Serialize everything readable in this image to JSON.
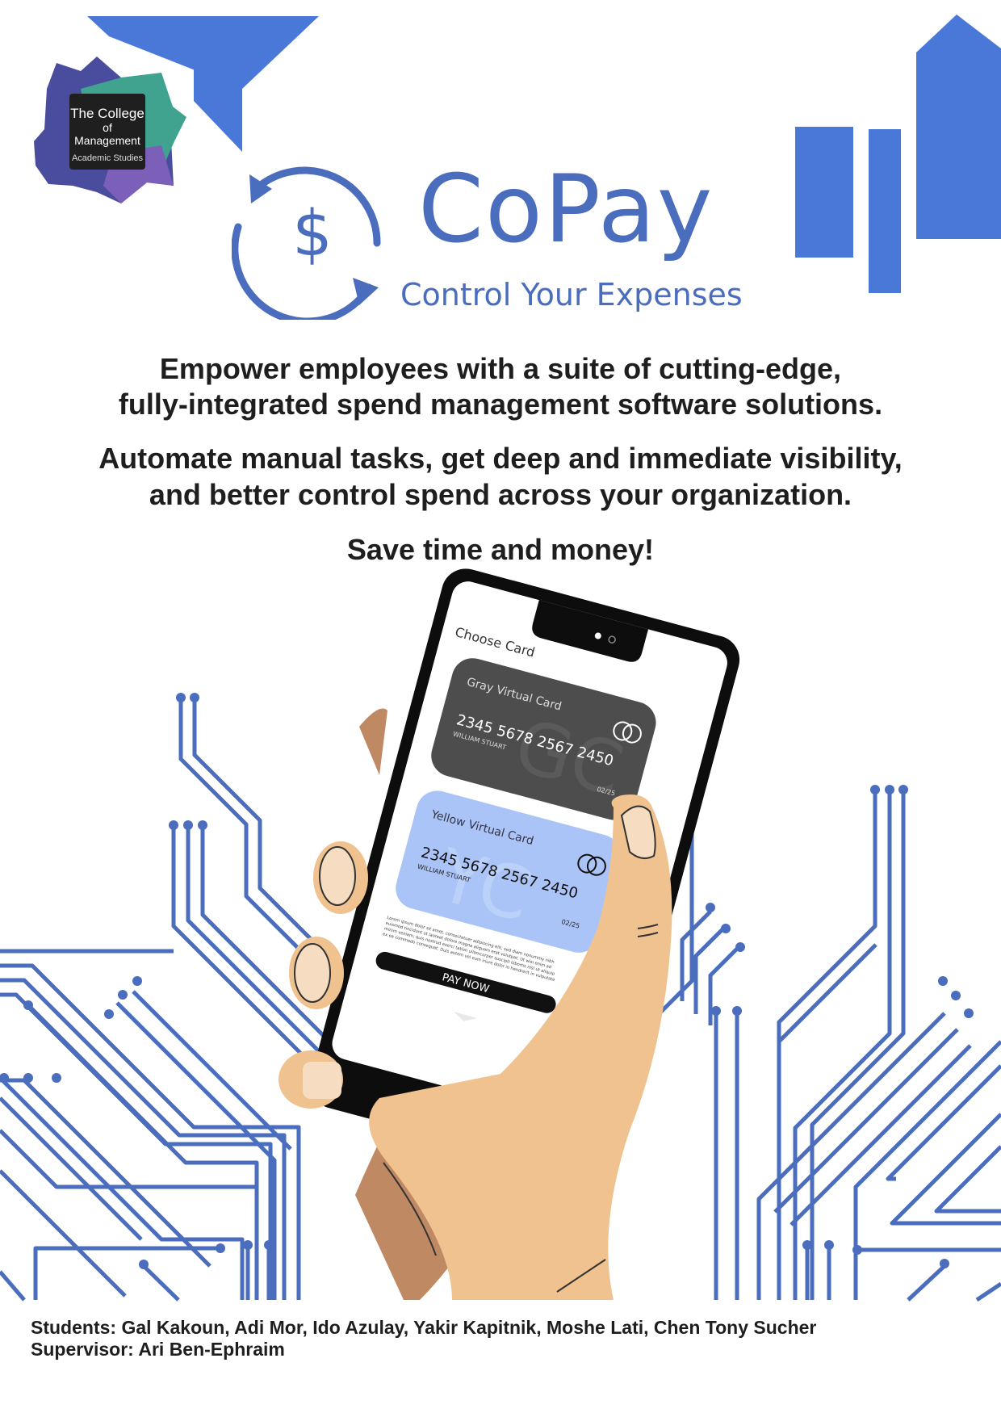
{
  "logo": {
    "line1": "The College",
    "line2": "of Management",
    "line3": "Academic Studies"
  },
  "brand": {
    "name": "CoPay",
    "tagline": "Control Your Expenses",
    "accent_color": "#4a6dbd",
    "shape_color": "#4a78d9"
  },
  "copy": {
    "line1": "Empower employees with a suite of cutting-edge,",
    "line2": "fully-integrated spend management software solutions.",
    "line3": "Automate manual tasks, get deep and immediate visibility,",
    "line4": "and better control spend across your organization.",
    "line5": "Save time and money!"
  },
  "phone": {
    "heading": "Choose Card",
    "gray_card": {
      "title": "Gray Virtual Card",
      "number": "2345 5678 2567 2450",
      "holder": "WILLIAM STUART",
      "expiry": "02/25",
      "watermark": "GC"
    },
    "blue_card": {
      "title": "Yellow Virtual Card",
      "number": "2345 5678 2567 2450",
      "holder": "WILLIAM STUART",
      "expiry": "02/25",
      "watermark": "YC"
    },
    "fine_print": [
      "Lorem ipsum dolor sit amet, consectetuer adipiscing elit, sed diam nonummy nibh",
      "euismod tincidunt ut laoreet dolore magna aliquam erat volutpat. Ut wisi enim ad",
      "minim veniam, quis nostrud exerci tation ullamcorper suscipit lobortis nisl ut aliquip",
      "ex ea commodo consequat. Duis autem vel eum iriure dolor in hendrerit in vulputate"
    ],
    "pay_button": "PAY NOW"
  },
  "credits": {
    "students": "Students: Gal Kakoun, Adi Mor, Ido Azulay, Yakir Kapitnik, Moshe Lati, Chen Tony Sucher",
    "supervisor": "Supervisor: Ari Ben-Ephraim"
  }
}
